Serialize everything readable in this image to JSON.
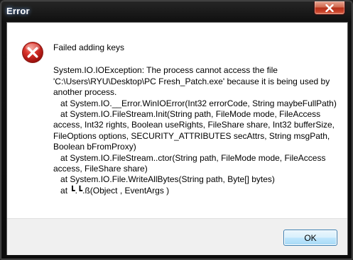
{
  "window": {
    "title": "Error",
    "close_icon": "close-icon"
  },
  "dialog": {
    "icon": "error-icon",
    "heading": "Failed adding keys",
    "message": "System.IO.IOException: The process cannot access the file 'C:\\Users\\RYU\\Desktop\\PC Fresh_Patch.exe' because it is being used by another process.\n   at System.IO.__Error.WinIOError(Int32 errorCode, String maybeFullPath)\n   at System.IO.FileStream.Init(String path, FileMode mode, FileAccess access, Int32 rights, Boolean useRights, FileShare share, Int32 bufferSize, FileOptions options, SECURITY_ATTRIBUTES secAttrs, String msgPath, Boolean bFromProxy)\n   at System.IO.FileStream..ctor(String path, FileMode mode, FileAccess access, FileShare share)\n   at System.IO.File.WriteAllBytes(String path, Byte[] bytes)\n   at ┗.┗.ß(Object , EventArgs )",
    "ok_label": "OK"
  },
  "colors": {
    "title_text": "#ffffff",
    "close_button": "#c8412a",
    "error_icon": "#c81d1d",
    "ok_border": "#3c7fb1"
  }
}
